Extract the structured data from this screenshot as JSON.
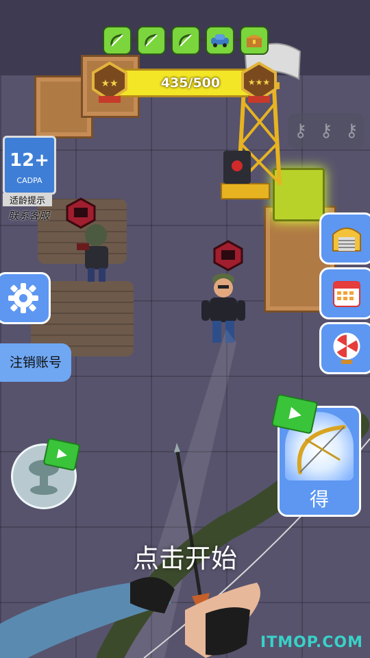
{
  "progress": {
    "nodes": [
      "bow-icon",
      "bow-icon",
      "bow-icon",
      "car-icon",
      "chest-icon"
    ],
    "xp_text": "435/500",
    "xp_fraction": 0.87
  },
  "age_rating": {
    "rating": "12+",
    "org": "CADPA",
    "caption": "适龄提示"
  },
  "support_text": "联系客服",
  "logout_label": "注销账号",
  "reward_card_label": "得",
  "start_prompt": "点击开始",
  "watermark": "ITMOP.COM",
  "keys": [
    "key-icon",
    "key-icon",
    "key-icon"
  ],
  "colors": {
    "accent_blue": "#5d97f2",
    "xp_yellow": "#f2e627",
    "node_green": "#7bd53d",
    "watermark": "#39d1c8"
  }
}
